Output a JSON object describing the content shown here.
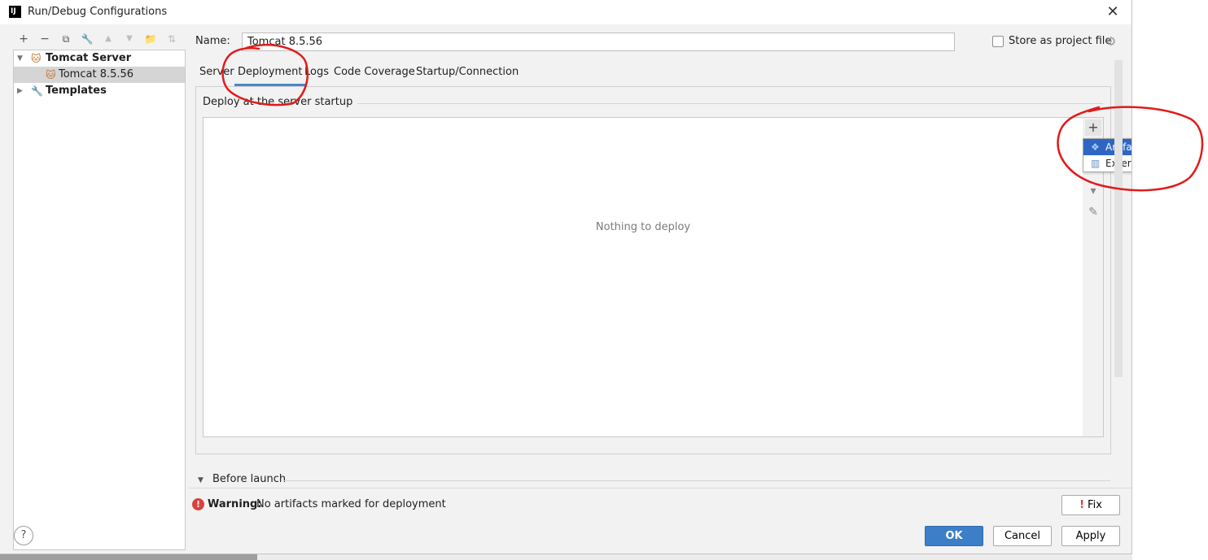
{
  "window": {
    "title": "Run/Debug Configurations",
    "logo_text": "IJ",
    "close_glyph": "✕"
  },
  "toolbar": {
    "add": "+",
    "remove": "−",
    "copy": "⧉",
    "edit_defaults": "🔧",
    "move_up": "▲",
    "move_down": "▼",
    "new_folder": "📁",
    "sort": "⇅"
  },
  "tree": {
    "items": [
      {
        "label": "Tomcat Server",
        "icon": "tomcat-icon",
        "expanded": true,
        "bold": true
      },
      {
        "label": "Tomcat 8.5.56",
        "icon": "tomcat-icon",
        "selected": true,
        "bold": false
      },
      {
        "label": "Templates",
        "icon": "wrench-icon",
        "expanded": false,
        "bold": true
      }
    ]
  },
  "form": {
    "name_label": "Name:",
    "name_value": "Tomcat 8.5.56",
    "store_label": "Store as project file",
    "store_checked": false
  },
  "tabs": [
    {
      "label": "Server",
      "active": false
    },
    {
      "label": "Deployment",
      "active": true
    },
    {
      "label": "Logs",
      "active": false
    },
    {
      "label": "Code Coverage",
      "active": false
    },
    {
      "label": "Startup/Connection",
      "active": false
    }
  ],
  "deployment": {
    "section_label": "Deploy at the server startup",
    "empty_text": "Nothing to deploy",
    "add_glyph": "+",
    "move_down_glyph": "▾",
    "edit_glyph": "✎",
    "popup": [
      {
        "label": "Artifact...",
        "icon": "artifact-icon",
        "selected": true
      },
      {
        "label": "External Source...",
        "icon": "external-source-icon",
        "selected": false
      }
    ]
  },
  "before_launch": {
    "label": "Before launch"
  },
  "warning": {
    "title": "Warning:",
    "text": "No artifacts marked for deployment",
    "icon": "!"
  },
  "buttons": {
    "fix": "Fix",
    "ok": "OK",
    "cancel": "Cancel",
    "apply": "Apply",
    "help": "?"
  },
  "colors": {
    "accent": "#3d7ec9",
    "selection": "#2f66c4",
    "annotation": "#e11b1b",
    "error": "#d9413e"
  }
}
